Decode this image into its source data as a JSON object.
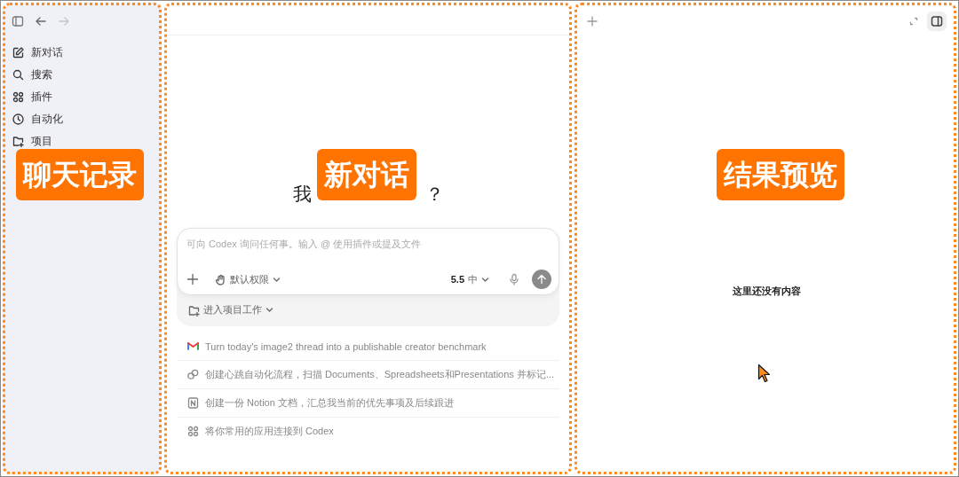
{
  "toolbar": {
    "back": {
      "disabled": false
    },
    "forward": {
      "disabled": true
    }
  },
  "sidebar": {
    "items": [
      {
        "label": "新对话",
        "kind": "compose"
      },
      {
        "label": "搜索",
        "kind": "search"
      },
      {
        "label": "插件",
        "kind": "plugins"
      },
      {
        "label": "自动化",
        "kind": "automation"
      },
      {
        "label": "项目",
        "kind": "project"
      }
    ],
    "annotation": "聊天记录"
  },
  "chat": {
    "annotation": "新对话",
    "heading_visible": [
      "我",
      "？"
    ],
    "composer": {
      "placeholder": "可向 Codex 询问任何事。输入 @ 使用插件或提及文件",
      "permission": "默认权限",
      "model": "5.5",
      "effort": "中"
    },
    "project_button": "进入项目工作",
    "suggestions": [
      {
        "kind": "mail",
        "text": "Turn today's image2 thread into a publishable creator benchmark"
      },
      {
        "kind": "loop",
        "text": "创建心跳自动化流程，扫描 Documents、Spreadsheets和Presentations 并标记..."
      },
      {
        "kind": "doc",
        "text": "创建一份 Notion 文档，汇总我当前的优先事项及后续跟进"
      },
      {
        "kind": "apps",
        "text": "将你常用的应用连接到 Codex"
      }
    ]
  },
  "preview": {
    "annotation": "结果预览",
    "empty_text": "这里还没有内容"
  }
}
